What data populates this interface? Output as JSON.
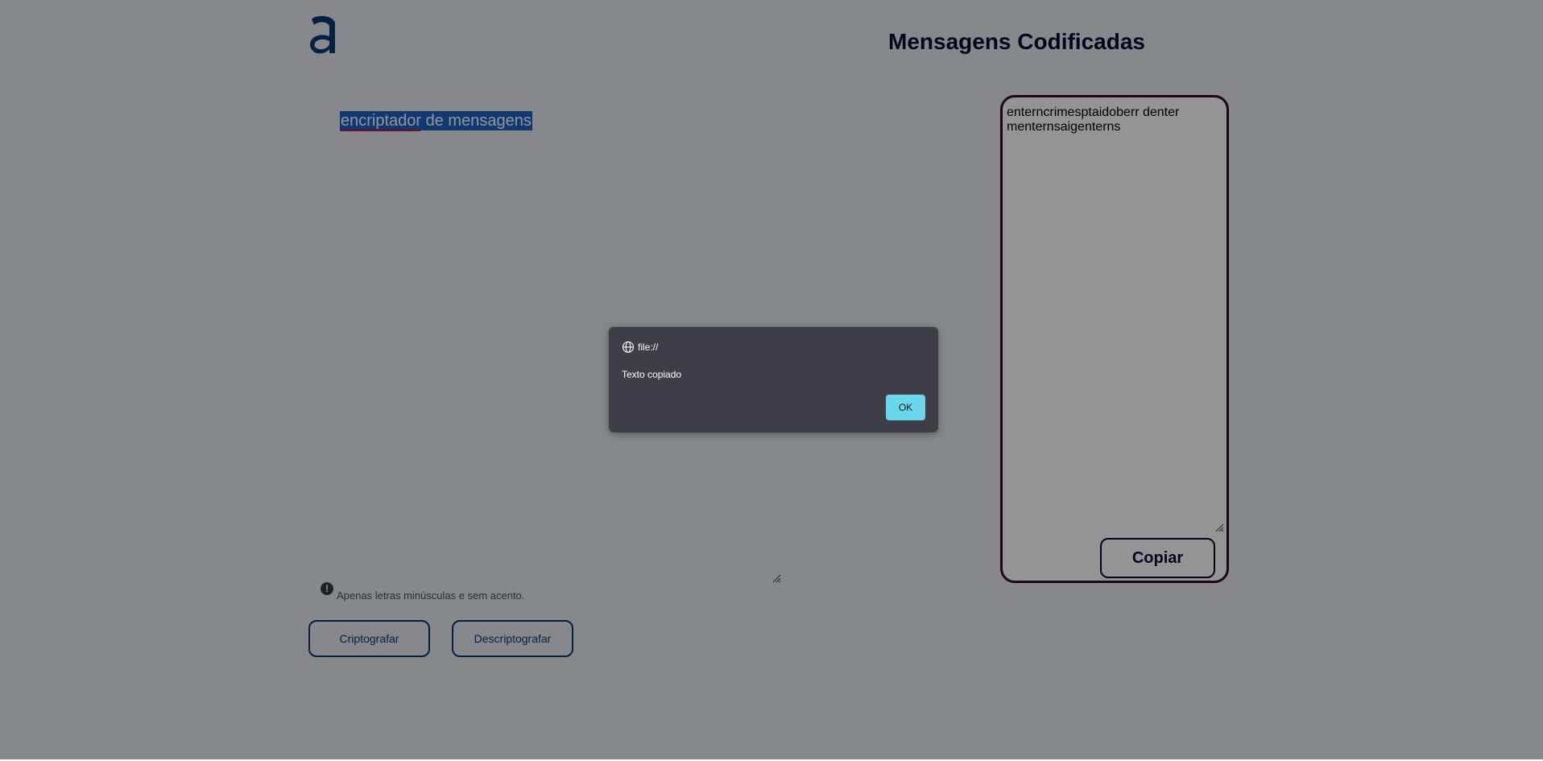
{
  "app": {
    "logo_icon": "alura-logo-icon",
    "brand_color": "#0a3871",
    "page_background": "#e7ebf2"
  },
  "header": {
    "title": "Mensagens Codificadas"
  },
  "input": {
    "value": "encriptador de mensagens",
    "selected": true
  },
  "hint": {
    "icon": "info-icon",
    "text": "Apenas letras minúsculas e sem acento."
  },
  "buttons": {
    "encrypt_label": "Criptografar",
    "decrypt_label": "Descriptografar"
  },
  "output": {
    "text": "enterncrimesptaidoberr denter menternsaigenterns",
    "border_color": "#2e0f2b",
    "copy_label": "Copiar"
  },
  "dialog": {
    "origin": "file://",
    "message": "Texto copiado",
    "ok_label": "OK",
    "ok_color": "#6ad7ea",
    "background": "#3f3e47"
  }
}
